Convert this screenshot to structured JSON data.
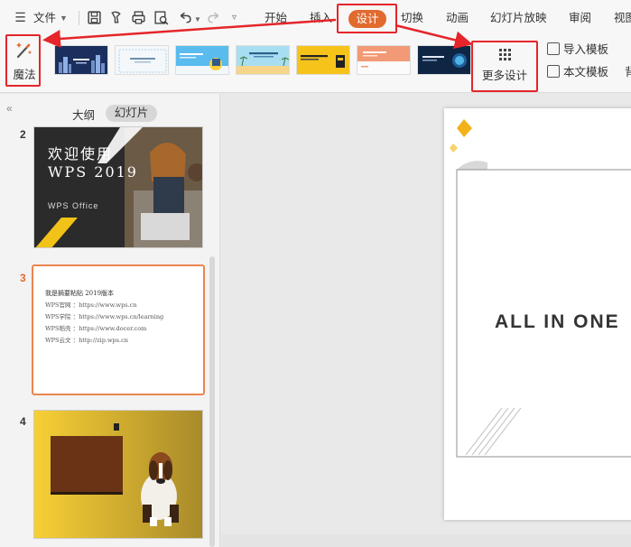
{
  "menubar": {
    "file_label": "文件",
    "tabs": [
      "开始",
      "插入",
      "设计",
      "切换",
      "动画",
      "幻灯片放映",
      "审阅",
      "视图"
    ],
    "active_tab": "设计"
  },
  "ribbon": {
    "magic_label": "魔法",
    "more_design_label": "更多设计",
    "import_template_label": "导入模板",
    "this_template_label": "本文模板",
    "cut_off_label": "背"
  },
  "panel": {
    "tab_outline": "大纲",
    "tab_slides": "幻灯片",
    "slides": [
      {
        "number": "2",
        "title": "欢迎使用",
        "subtitle": "WPS 2019",
        "brand": "WPS Office"
      },
      {
        "number": "3",
        "lines": [
          "我是摘要粘贴 2019版本",
          "WPS官网 ：https://www.wps.cn",
          "WPS学院 ：https://www.wps.cn/learning",
          "WPS稻壳 ：https://www.docer.com",
          "WPS云文 ：http://zip.wps.cn"
        ]
      },
      {
        "number": "4"
      }
    ]
  },
  "canvas": {
    "title_text": "ALL IN ONE"
  },
  "colors": {
    "accent": "#e16a2f",
    "highlight": "#e5252a"
  }
}
